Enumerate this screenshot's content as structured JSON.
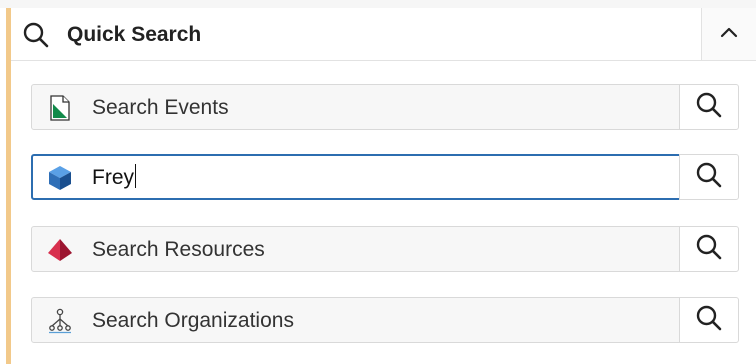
{
  "header": {
    "title": "Quick Search",
    "icon": "search-icon",
    "collapse_icon": "chevron-up-icon"
  },
  "fields": [
    {
      "value": "",
      "placeholder": "Search Events",
      "icon": "events-document-icon",
      "active": false
    },
    {
      "value": "Frey",
      "placeholder": "",
      "icon": "blue-cube-icon",
      "active": true
    },
    {
      "value": "",
      "placeholder": "Search Resources",
      "icon": "red-pyramid-icon",
      "active": false
    },
    {
      "value": "",
      "placeholder": "Search Organizations",
      "icon": "org-chart-icon",
      "active": false
    }
  ],
  "colors": {
    "accent": "#f2c98a",
    "active_border": "#2c6db0"
  }
}
